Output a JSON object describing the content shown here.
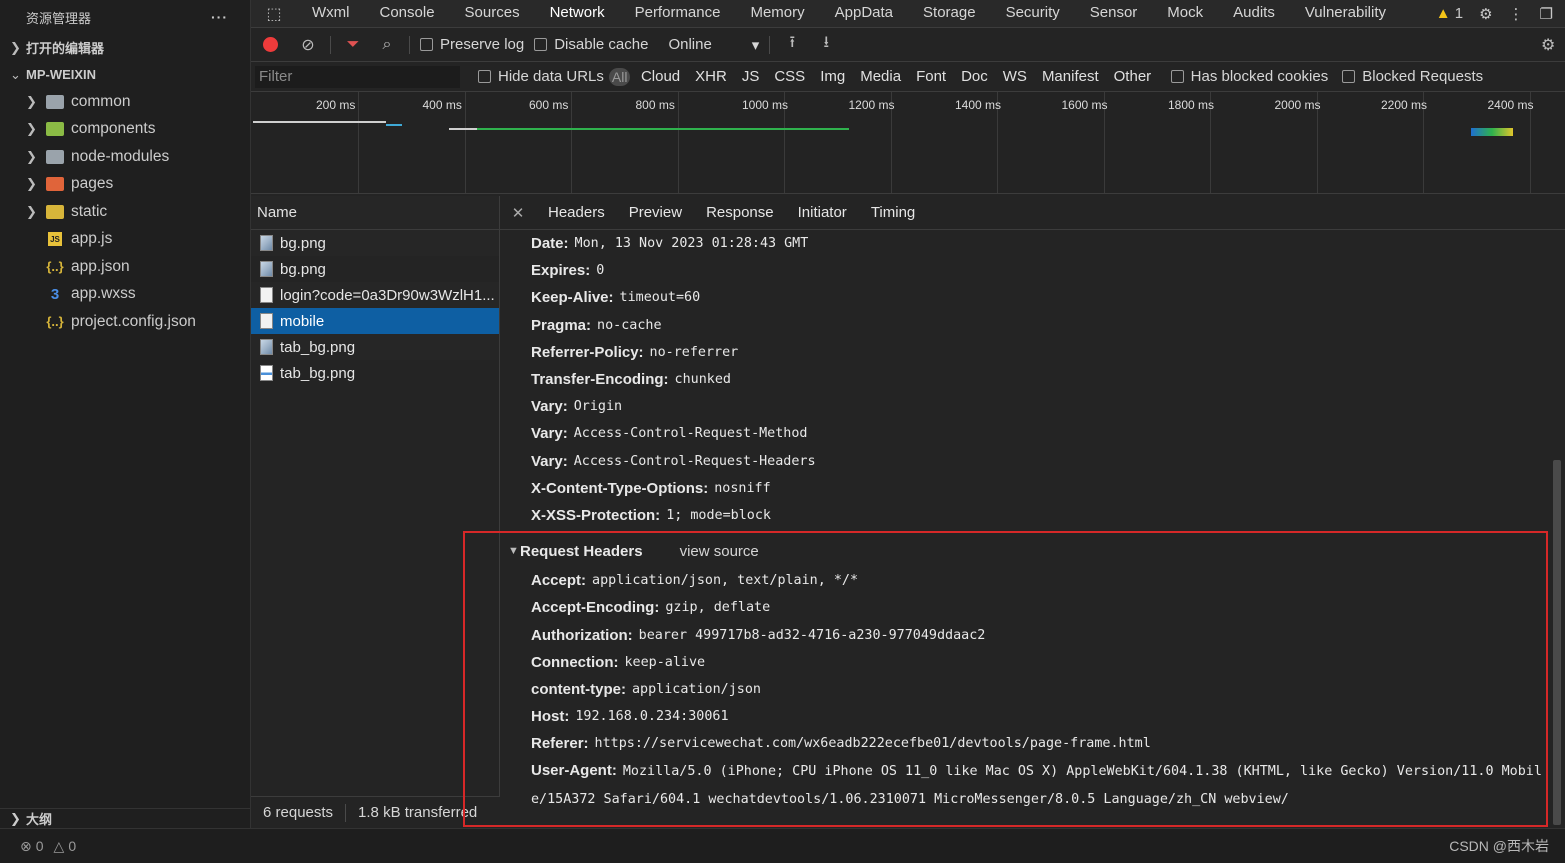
{
  "explorer": {
    "title": "资源管理器",
    "more": "···",
    "open_editors": "打开的编辑器",
    "project": "MP-WEIXIN",
    "items": [
      {
        "label": "common",
        "type": "folder",
        "icon": "folder-icon"
      },
      {
        "label": "components",
        "type": "folder",
        "icon": "folder-components-icon"
      },
      {
        "label": "node-modules",
        "type": "folder",
        "icon": "folder-icon"
      },
      {
        "label": "pages",
        "type": "folder",
        "icon": "folder-pages-icon"
      },
      {
        "label": "static",
        "type": "folder",
        "icon": "folder-static-icon"
      },
      {
        "label": "app.js",
        "type": "file",
        "icon": "js-file-icon",
        "badge": "JS"
      },
      {
        "label": "app.json",
        "type": "file",
        "icon": "json-file-icon",
        "badge": "{..}"
      },
      {
        "label": "app.wxss",
        "type": "file",
        "icon": "css-file-icon",
        "badge": "3"
      },
      {
        "label": "project.config.json",
        "type": "file",
        "icon": "json-file-icon",
        "badge": "{..}"
      }
    ],
    "outline": "大纲"
  },
  "devtools": {
    "tabs": [
      "Wxml",
      "Console",
      "Sources",
      "Network",
      "Performance",
      "Memory",
      "AppData",
      "Storage",
      "Security",
      "Sensor",
      "Mock",
      "Audits",
      "Vulnerability"
    ],
    "active_tab": "Network",
    "warnings_count": "1",
    "toolbar": {
      "preserve_log": "Preserve log",
      "disable_cache": "Disable cache",
      "throttle": "Online"
    },
    "filter": {
      "placeholder": "Filter",
      "hide_data_urls": "Hide data URLs",
      "all": "All",
      "types": [
        "Cloud",
        "XHR",
        "JS",
        "CSS",
        "Img",
        "Media",
        "Font",
        "Doc",
        "WS",
        "Manifest",
        "Other"
      ],
      "has_blocked_cookies": "Has blocked cookies",
      "blocked_requests": "Blocked Requests"
    },
    "timeline": {
      "ticks": [
        "200 ms",
        "400 ms",
        "600 ms",
        "800 ms",
        "1000 ms",
        "1200 ms",
        "1400 ms",
        "1600 ms",
        "1800 ms",
        "2000 ms",
        "2200 ms",
        "2400 ms"
      ]
    },
    "requests": {
      "column": "Name",
      "rows": [
        {
          "name": "bg.png",
          "icon": "image-file-icon"
        },
        {
          "name": "bg.png",
          "icon": "image-file-icon"
        },
        {
          "name": "login?code=0a3Dr90w3WzlH1...",
          "icon": "document-file-icon"
        },
        {
          "name": "mobile",
          "icon": "document-file-icon",
          "selected": true
        },
        {
          "name": "tab_bg.png",
          "icon": "image-file-icon"
        },
        {
          "name": "tab_bg.png",
          "icon": "image-file-icon"
        }
      ],
      "summary_requests": "6 requests",
      "summary_transferred": "1.8 kB transferred"
    },
    "details": {
      "tabs": [
        "Headers",
        "Preview",
        "Response",
        "Initiator",
        "Timing"
      ],
      "response_headers": [
        {
          "key": "Date:",
          "value": "Mon, 13 Nov 2023 01:28:43 GMT"
        },
        {
          "key": "Expires:",
          "value": "0"
        },
        {
          "key": "Keep-Alive:",
          "value": "timeout=60"
        },
        {
          "key": "Pragma:",
          "value": "no-cache"
        },
        {
          "key": "Referrer-Policy:",
          "value": "no-referrer"
        },
        {
          "key": "Transfer-Encoding:",
          "value": "chunked"
        },
        {
          "key": "Vary:",
          "value": "Origin"
        },
        {
          "key": "Vary:",
          "value": "Access-Control-Request-Method"
        },
        {
          "key": "Vary:",
          "value": "Access-Control-Request-Headers"
        },
        {
          "key": "X-Content-Type-Options:",
          "value": "nosniff"
        },
        {
          "key": "X-XSS-Protection:",
          "value": "1; mode=block"
        }
      ],
      "request_section": {
        "title": "Request Headers",
        "view_source": "view source"
      },
      "request_headers": [
        {
          "key": "Accept:",
          "value": "application/json, text/plain, */*"
        },
        {
          "key": "Accept-Encoding:",
          "value": "gzip, deflate"
        },
        {
          "key": "Authorization:",
          "value": "bearer 499717b8-ad32-4716-a230-977049ddaac2"
        },
        {
          "key": "Connection:",
          "value": "keep-alive"
        },
        {
          "key": "content-type:",
          "value": "application/json"
        },
        {
          "key": "Host:",
          "value": "192.168.0.234:30061"
        },
        {
          "key": "Referer:",
          "value": "https://servicewechat.com/wx6eadb222ecefbe01/devtools/page-frame.html"
        }
      ],
      "user_agent": {
        "key": "User-Agent:",
        "value": "Mozilla/5.0 (iPhone; CPU iPhone OS 11_0 like Mac OS X) AppleWebKit/604.1.38 (KHTML, like Gecko) Version/11.0 Mobile/15A372 Safari/604.1 wechatdevtools/1.06.2310071 MicroMessenger/8.0.5 Language/zh_CN webview/"
      }
    }
  },
  "statusbar": {
    "errors": "0",
    "warnings": "0",
    "watermark": "CSDN @西木岩"
  },
  "colors": {
    "accent_selected": "#0e5fa3",
    "record": "#ee3b3b",
    "highlight_box": "#d62828"
  }
}
